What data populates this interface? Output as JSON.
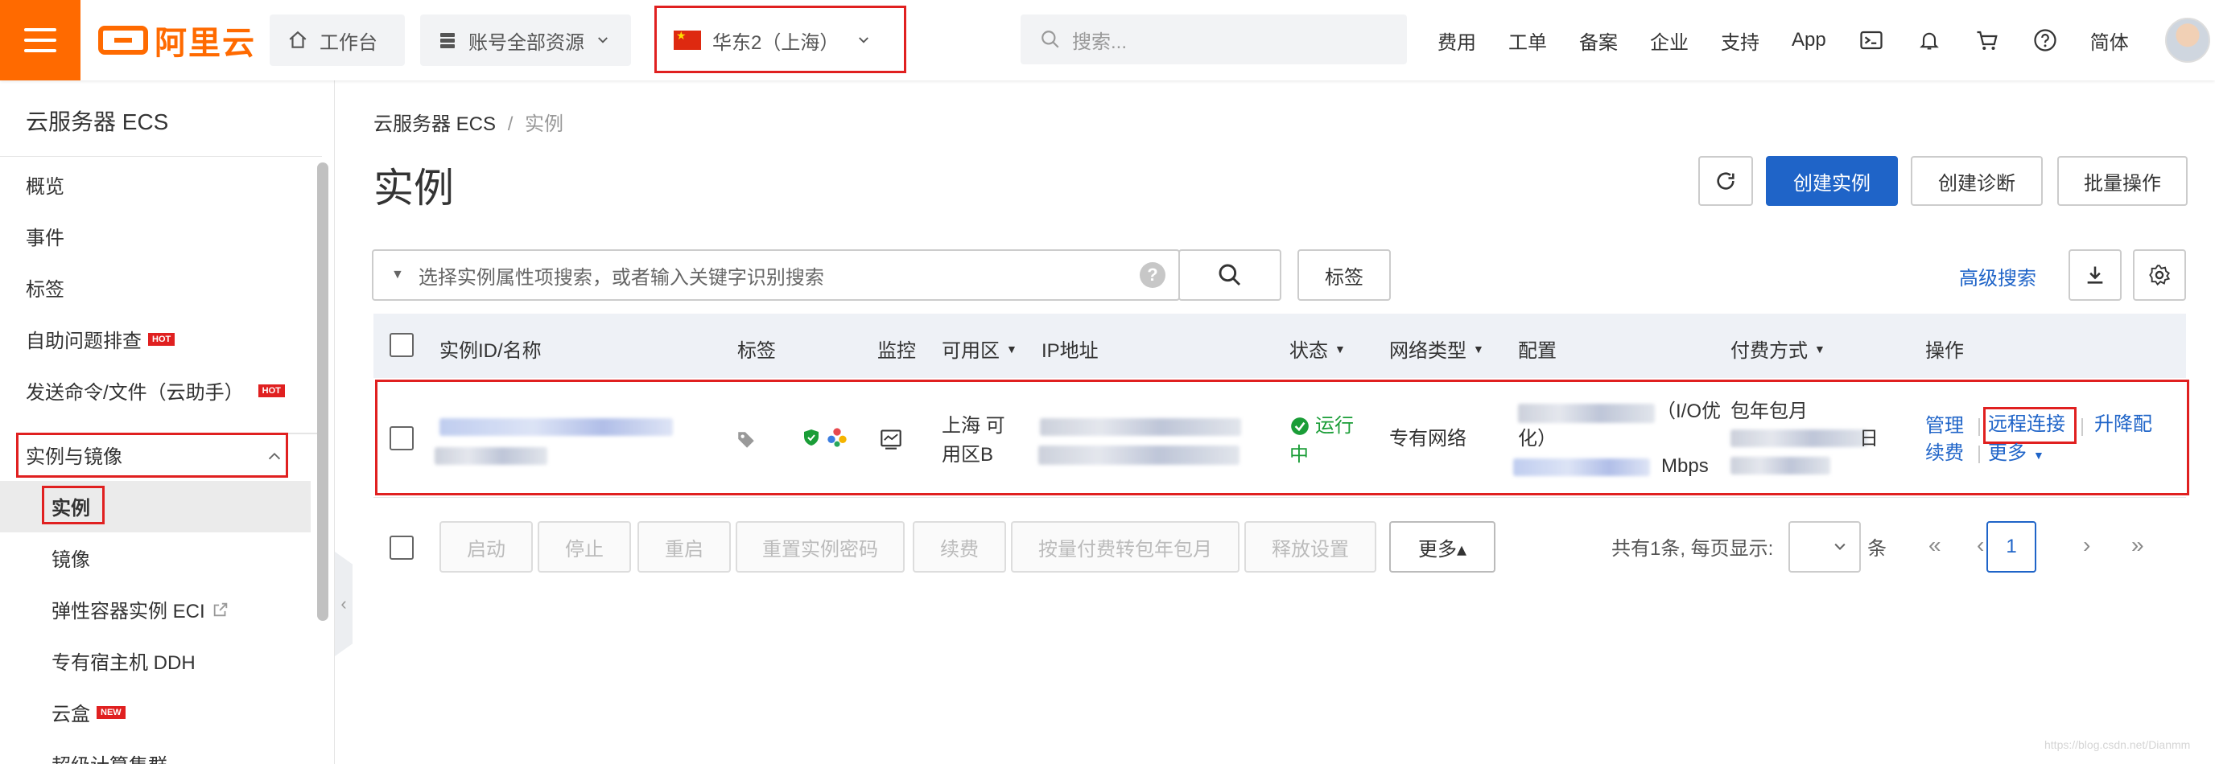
{
  "topbar": {
    "logo_text": "阿里云",
    "workbench": "工作台",
    "resources": "账号全部资源",
    "region": "华东2（上海）",
    "search_placeholder": "搜索...",
    "links": [
      "费用",
      "工单",
      "备案",
      "企业",
      "支持",
      "App"
    ],
    "lang": "简体"
  },
  "sidebar": {
    "title": "云服务器 ECS",
    "items": [
      "概览",
      "事件",
      "标签",
      "自助问题排查",
      "发送命令/文件（云助手）"
    ],
    "hot_badge": "HOT",
    "group": "实例与镜像",
    "sub_items": [
      "实例",
      "镜像",
      "弹性容器实例 ECI",
      "专有宿主机 DDH",
      "云盒"
    ],
    "new_badge": "NEW",
    "cut_item": "超级计算集群"
  },
  "main": {
    "breadcrumb_root": "云服务器 ECS",
    "breadcrumb_sep": "/",
    "breadcrumb_current": "实例",
    "title": "实例",
    "create_instance": "创建实例",
    "create_diagnosis": "创建诊断",
    "batch_ops": "批量操作",
    "filter_placeholder": "选择实例属性项搜索，或者输入关键字识别搜索",
    "tag_btn": "标签",
    "advanced_search": "高级搜索"
  },
  "table": {
    "headers": {
      "id_name": "实例ID/名称",
      "tag": "标签",
      "monitor": "监控",
      "zone": "可用区",
      "ip": "IP地址",
      "status": "状态",
      "network": "网络类型",
      "config": "配置",
      "billing": "付费方式",
      "actions": "操作"
    },
    "row": {
      "zone_line1": "上海 可",
      "zone_line2": "用区B",
      "status_line1": "运行",
      "status_line2": "中",
      "network": "专有网络",
      "config_suffix1": "（I/O优",
      "config_suffix2": "化）",
      "config_suffix3": "Mbps",
      "billing": "包年包月",
      "billing_tail": "日",
      "act_manage": "管理",
      "act_remote": "远程连接",
      "act_resize": "升降配",
      "act_renew": "续费",
      "act_more": "更多"
    }
  },
  "footer": {
    "buttons": [
      "启动",
      "停止",
      "重启",
      "重置实例密码",
      "续费",
      "按量付费转包年包月",
      "释放设置"
    ],
    "more": "更多▴",
    "total": "共有1条, 每页显示:",
    "unit": "条",
    "current_page": "1"
  },
  "watermark": "https://blog.csdn.net/Dianmm",
  "colors": {
    "brand": "#ff6a00",
    "primary": "#1f64c8",
    "highlight": "#e02020",
    "success": "#1a9d37"
  }
}
